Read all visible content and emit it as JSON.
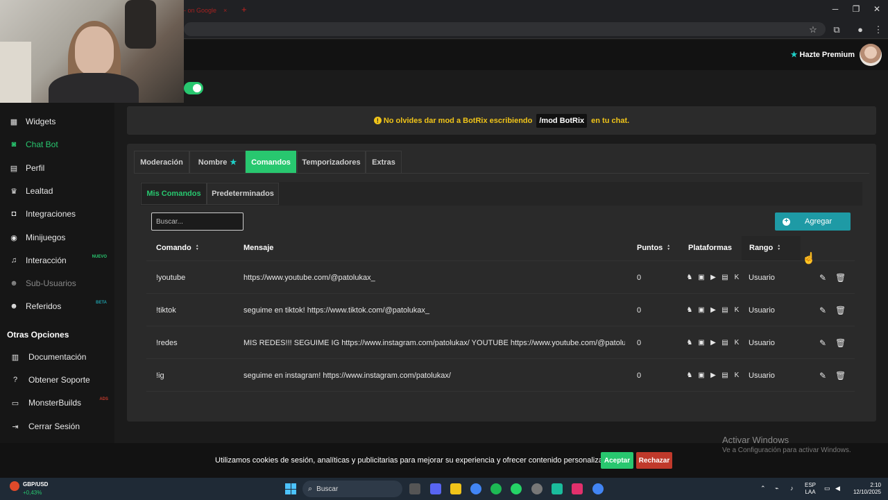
{
  "browser": {
    "tab_title": "- on Google",
    "tab_close": "×",
    "new_tab": "+",
    "window_min": "─",
    "window_max": "❐",
    "window_close": "✕"
  },
  "header": {
    "premium_label": "Hazte Premium"
  },
  "sidebar": {
    "items": [
      {
        "label": "Widgets",
        "icon": "widgets-icon"
      },
      {
        "label": "Chat Bot",
        "icon": "robot-icon"
      },
      {
        "label": "Perfil",
        "icon": "id-card-icon"
      },
      {
        "label": "Lealtad",
        "icon": "trophy-icon"
      },
      {
        "label": "Integraciones",
        "icon": "discord-icon"
      },
      {
        "label": "Minijuegos",
        "icon": "gamepad-icon"
      },
      {
        "label": "Interacción",
        "icon": "music-icon",
        "badge": "NUEVO"
      },
      {
        "label": "Sub-Usuarios",
        "icon": "users-icon"
      },
      {
        "label": "Referidos",
        "icon": "users-icon",
        "badge": "BETA"
      }
    ],
    "section_title": "Otras Opciones",
    "other_items": [
      {
        "label": "Documentación",
        "icon": "book-icon"
      },
      {
        "label": "Obtener Soporte",
        "icon": "help-icon"
      },
      {
        "label": "MonsterBuilds",
        "icon": "monitor-icon",
        "badge": "ADS"
      },
      {
        "label": "Cerrar Sesión",
        "icon": "logout-icon"
      }
    ]
  },
  "notice": {
    "before": "No olvides dar mod a BotRix escribiendo",
    "command": "/mod BotRix",
    "after": "en tu chat."
  },
  "tabs": [
    "Moderación",
    "Nombre",
    "Comandos",
    "Temporizadores",
    "Extras"
  ],
  "active_tab": "Comandos",
  "subtabs": [
    "Mis Comandos",
    "Predeterminados"
  ],
  "active_subtab": "Mis Comandos",
  "search": {
    "placeholder": "Buscar..."
  },
  "add_button": "Agregar",
  "table": {
    "columns": [
      "Comando",
      "Mensaje",
      "Puntos",
      "Plataformas",
      "Rango"
    ],
    "rows": [
      {
        "command": "!youtube",
        "message": "https://www.youtube.com/@patolukax_",
        "points": "0",
        "rank": "Usuario"
      },
      {
        "command": "!tiktok",
        "message": "seguime en tiktok! https://www.tiktok.com/@patolukax_",
        "points": "0",
        "rank": "Usuario"
      },
      {
        "command": "!redes",
        "message": "MIS REDES!!! SEGUIME IG https://www.instagram.com/patolukax/ YOUTUBE https://www.youtube.com/@patoluka...",
        "points": "0",
        "rank": "Usuario"
      },
      {
        "command": "!ig",
        "message": "seguime en instagram! https://www.instagram.com/patolukax/",
        "points": "0",
        "rank": "Usuario"
      }
    ]
  },
  "cookie": {
    "text": "Utilizamos cookies de sesión, analíticas y publicitarias para mejorar su experiencia y ofrecer contenido personalizado.",
    "accept": "Aceptar",
    "reject": "Rechazar"
  },
  "watermark": {
    "title": "Activar Windows",
    "subtitle": "Ve a Configuración para activar Windows."
  },
  "taskbar": {
    "ticker_name": "GBP/USD",
    "ticker_change": "+0,43%",
    "search_label": "Buscar",
    "lang_line1": "ESP",
    "lang_line2": "LAA",
    "time": "2:10",
    "date": "12/10/2025"
  },
  "colors": {
    "accent": "#28c76f",
    "teal": "#1e9aa5",
    "warning": "#f0c419",
    "danger": "#c0392b"
  }
}
